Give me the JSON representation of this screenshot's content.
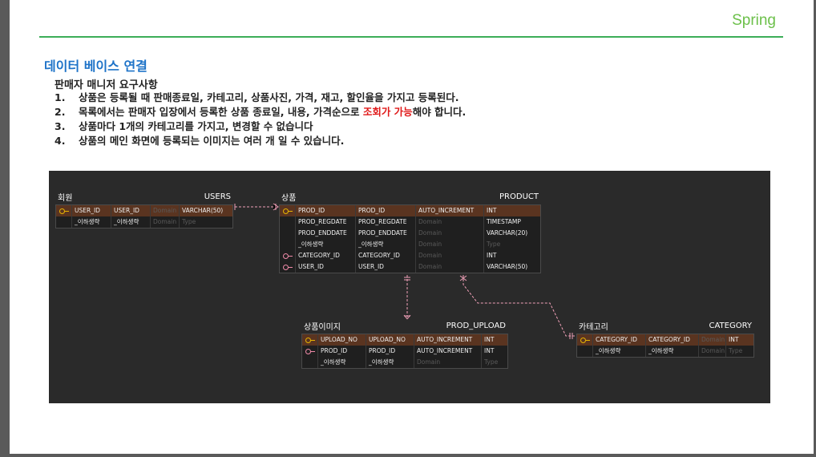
{
  "brand": "Spring",
  "section_title": "데이터 베이스 연결",
  "subtitle": "판매자 매니저 요구사항",
  "requirements": [
    {
      "num": "1.",
      "text": "상품은 등록될 때 판매종료일, 카테고리, 상품사진, 가격, 재고, 할인율을 가지고 등록된다."
    },
    {
      "num": "2.",
      "pre": "목록에서는 판매자 입장에서 등록한 상품 종료일, 내용, 가격순으로 ",
      "highlight": "조회가 가능",
      "post": "해야 합니다."
    },
    {
      "num": "3.",
      "text": "상품마다 1개의 카테고리를 가지고, 변경할 수 없습니다"
    },
    {
      "num": "4.",
      "text": "상품의 메인 화면에 등록되는 이미지는 여러 개 일 수 있습니다."
    }
  ],
  "colors": {
    "accent_green": "#3cae58",
    "title_blue": "#1e73c8",
    "highlight_red": "#e01818",
    "erd_bg": "#2a2a2a",
    "pk_row": "#5a3420"
  },
  "erd": {
    "users": {
      "logical": "회원",
      "physical": "USERS",
      "rows": [
        {
          "icon": "pk-key-icon",
          "c1": "USER_ID",
          "c2": "USER_ID",
          "c3": "Domain",
          "c4": "VARCHAR(50)"
        },
        {
          "icon": "",
          "c1": "_이하생략",
          "c2": "_이하생략",
          "c3": "Domain",
          "c4": "Type"
        }
      ]
    },
    "product": {
      "logical": "상품",
      "physical": "PRODUCT",
      "rows": [
        {
          "icon": "pk-key-icon",
          "c1": "PROD_ID",
          "c2": "PROD_ID",
          "c3": "AUTO_INCREMENT",
          "c4": "INT"
        },
        {
          "icon": "",
          "c1": "PROD_REGDATE",
          "c2": "PROD_REGDATE",
          "c3": "Domain",
          "c4": "TIMESTAMP"
        },
        {
          "icon": "",
          "c1": "PROD_ENDDATE",
          "c2": "PROD_ENDDATE",
          "c3": "Domain",
          "c4": "VARCHAR(20)"
        },
        {
          "icon": "",
          "c1": "_이하생략",
          "c2": "_이하생략",
          "c3": "Domain",
          "c4": "Type"
        },
        {
          "icon": "fk-key-icon",
          "c1": "CATEGORY_ID",
          "c2": "CATEGORY_ID",
          "c3": "Domain",
          "c4": "INT"
        },
        {
          "icon": "fk-key-icon",
          "c1": "USER_ID",
          "c2": "USER_ID",
          "c3": "Domain",
          "c4": "VARCHAR(50)"
        }
      ]
    },
    "prod_upload": {
      "logical": "상품이미지",
      "physical": "PROD_UPLOAD",
      "rows": [
        {
          "icon": "pk-key-icon",
          "c1": "UPLOAD_NO",
          "c2": "UPLOAD_NO",
          "c3": "AUTO_INCREMENT",
          "c4": "INT"
        },
        {
          "icon": "fk-key-icon",
          "c1": "PROD_ID",
          "c2": "PROD_ID",
          "c3": "AUTO_INCREMENT",
          "c4": "INT"
        },
        {
          "icon": "",
          "c1": "_이하생략",
          "c2": "_이하생략",
          "c3": "Domain",
          "c4": "Type"
        }
      ]
    },
    "category": {
      "logical": "카테고리",
      "physical": "CATEGORY",
      "rows": [
        {
          "icon": "pk-key-icon",
          "c1": "CATEGORY_ID",
          "c2": "CATEGORY_ID",
          "c3": "Domain",
          "c4": "INT"
        },
        {
          "icon": "",
          "c1": "_이하생략",
          "c2": "_이하생략",
          "c3": "Domain",
          "c4": "Type"
        }
      ]
    }
  }
}
